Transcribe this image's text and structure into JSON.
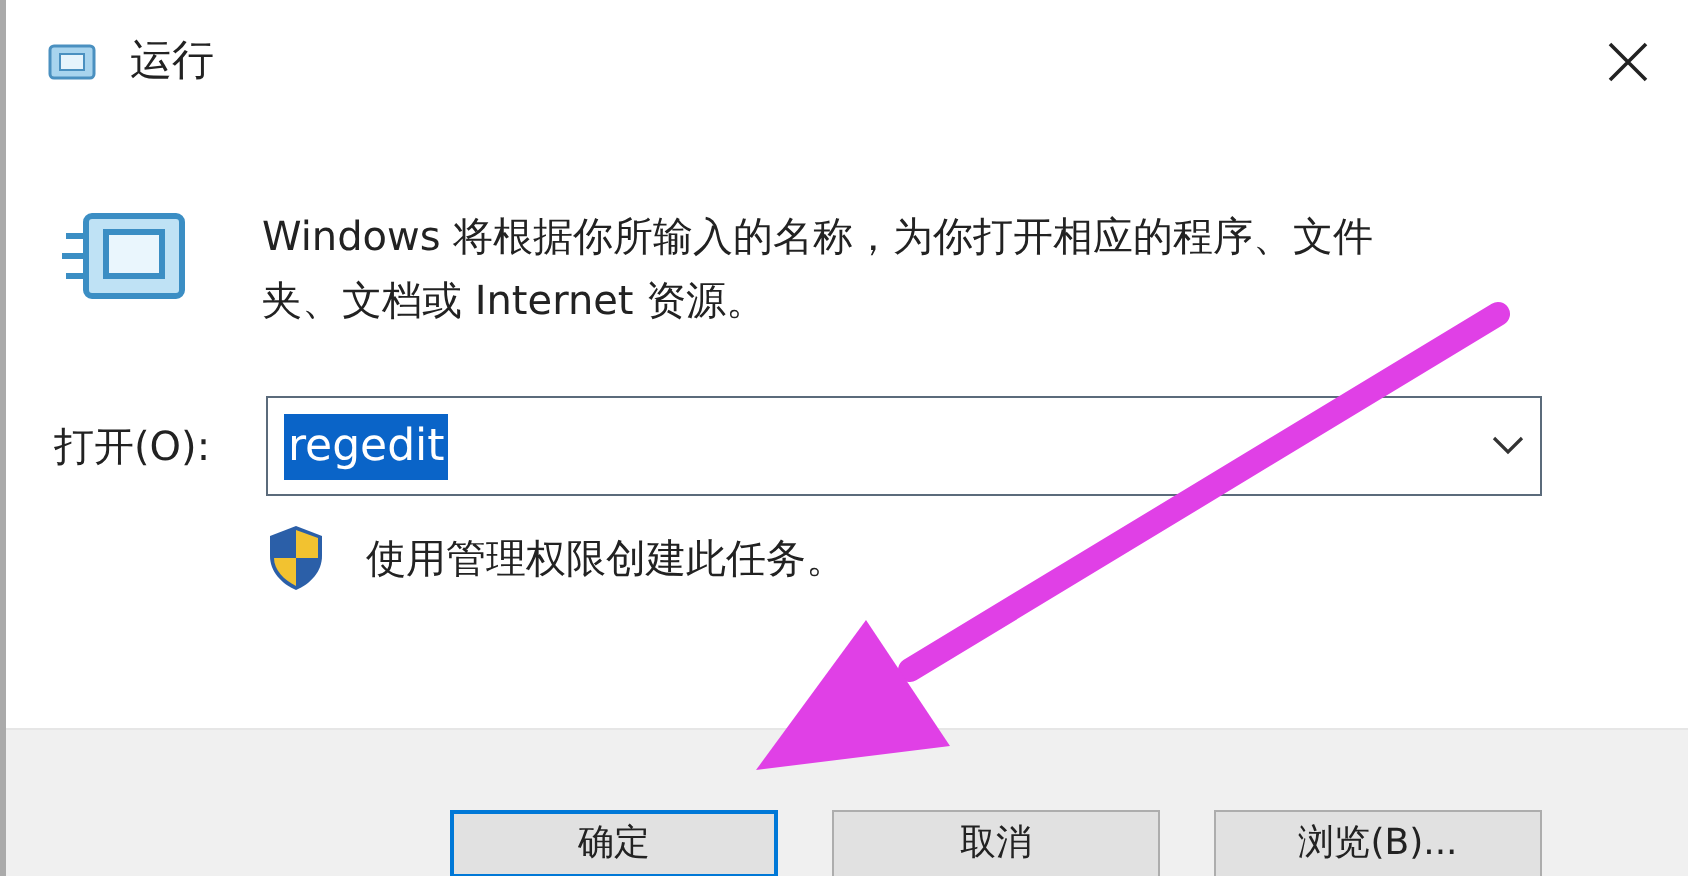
{
  "window": {
    "title": "运行"
  },
  "description": "Windows 将根据你所输入的名称，为你打开相应的程序、文件夹、文档或 Internet 资源。",
  "open_field": {
    "label": "打开(O):",
    "value": "regedit",
    "selected": true
  },
  "admin_note": "使用管理权限创建此任务。",
  "buttons": [
    {
      "label": "确定",
      "default": true
    },
    {
      "label": "取消",
      "default": false
    },
    {
      "label": "浏览(B)...",
      "default": false
    }
  ]
}
